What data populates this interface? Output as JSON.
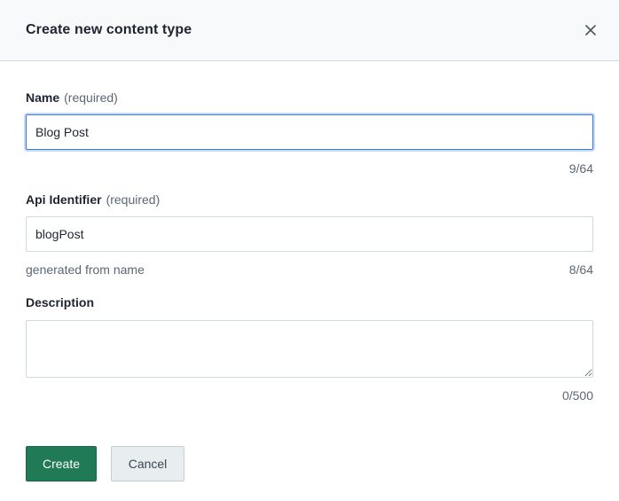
{
  "dialog": {
    "title": "Create new content type",
    "close_icon": "close-icon"
  },
  "form": {
    "name": {
      "label": "Name",
      "required_note": "(required)",
      "value": "Blog Post",
      "counter": "9/64"
    },
    "api_identifier": {
      "label": "Api Identifier",
      "required_note": "(required)",
      "value": "blogPost",
      "helper": "generated from name",
      "counter": "8/64"
    },
    "description": {
      "label": "Description",
      "value": "",
      "counter": "0/500"
    }
  },
  "actions": {
    "create_label": "Create",
    "cancel_label": "Cancel"
  },
  "colors": {
    "primary": "#1f7a55",
    "focus": "#3b7ad7",
    "header_bg": "#f7f9fa"
  }
}
